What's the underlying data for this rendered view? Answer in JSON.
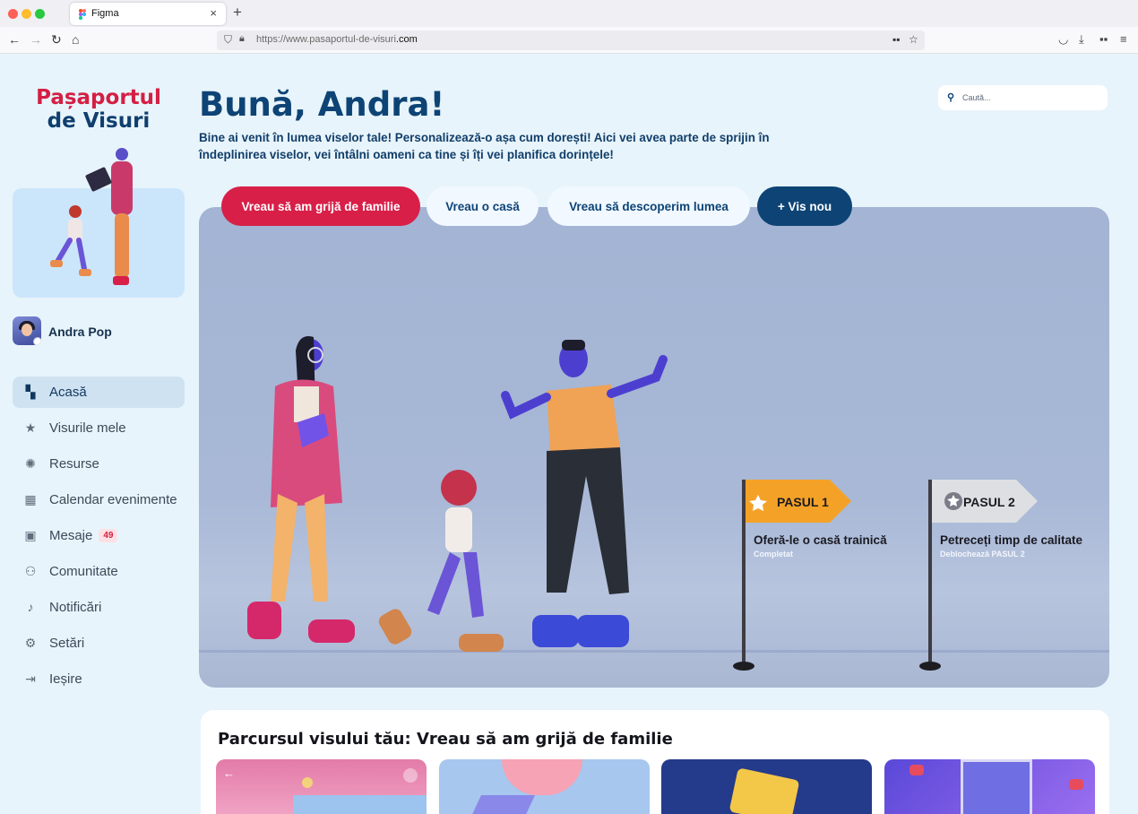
{
  "browser": {
    "tab_title": "Figma",
    "tab_close": "×",
    "new_tab": "+",
    "url_host": "https://www.pasaportul-de-visuri",
    "url_tld": ".com",
    "icons": [
      "back-icon",
      "forward-icon",
      "reload-icon",
      "home-icon",
      "shield-icon",
      "lock-icon",
      "extensions-icon",
      "bookmark-star-icon",
      "pocket-icon",
      "download-icon",
      "apps-icon",
      "menu-icon"
    ]
  },
  "brand": {
    "line1": "Pașaportul",
    "line2": "de Visuri",
    "color_primary": "#d41f44",
    "color_secondary": "#0f3f6e"
  },
  "user": {
    "name": "Andra Pop"
  },
  "menu": [
    {
      "label": "Acasă",
      "icon": "grid-icon",
      "active": true
    },
    {
      "label": "Visurile mele",
      "icon": "star-icon"
    },
    {
      "label": "Resurse",
      "icon": "lightbulb-icon"
    },
    {
      "label": "Calendar evenimente",
      "icon": "calendar-icon"
    },
    {
      "label": "Mesaje",
      "icon": "messages-icon",
      "count": "49"
    },
    {
      "label": "Comunitate",
      "icon": "community-icon"
    },
    {
      "label": "Notificări",
      "icon": "bell-icon"
    },
    {
      "label": "Setări",
      "icon": "gear-icon"
    },
    {
      "label": "Ieșire",
      "icon": "logout-icon"
    }
  ],
  "header": {
    "title": "Bună, Andra!",
    "subtitle": "Bine ai venit în lumea viselor tale! Personalizează-o așa cum dorești! Aici vei avea parte de sprijin în îndeplinirea viselor, vei întâlni oameni ca tine și îți vei planifica dorințele!"
  },
  "search": {
    "placeholder": "Caută..."
  },
  "dream_tabs": [
    {
      "label": "Vreau să am grijă de familie",
      "active": true
    },
    {
      "label": "Vreau o casă"
    },
    {
      "label": "Vreau să descoperim lumea"
    },
    {
      "label": "+ Vis nou"
    }
  ],
  "steps": [
    {
      "flag": "PASUL 1",
      "title": "Oferă-le o casă trainică",
      "status": "Completat",
      "color": "#f4a227"
    },
    {
      "flag": "PASUL 2",
      "title": "Petreceți timp de calitate",
      "status": "Deblochează PASUL 2",
      "color": "#dedfe3"
    }
  ],
  "journey": {
    "title": "Parcursul visului tău:  Vreau să am grijă de familie"
  },
  "accent": {
    "red": "#d81f48",
    "navy": "#0d4475"
  }
}
